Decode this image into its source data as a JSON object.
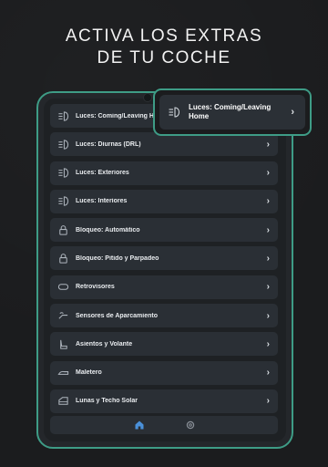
{
  "headline": {
    "line1": "ACTIVA LOS EXTRAS",
    "line2": "DE TU COCHE"
  },
  "colors": {
    "accent": "#3e9c86",
    "background": "#1b1c1e",
    "card": "#2a2f35",
    "home_active": "#4a90d9"
  },
  "menu": {
    "items": [
      {
        "label": "Luces: Coming/Leaving Home",
        "icon": "headlight-icon"
      },
      {
        "label": "Luces: Diurnas (DRL)",
        "icon": "headlight-icon"
      },
      {
        "label": "Luces: Exteriores",
        "icon": "headlight-icon"
      },
      {
        "label": "Luces: Interiores",
        "icon": "headlight-icon"
      },
      {
        "label": "Bloqueo: Automático",
        "icon": "lock-icon"
      },
      {
        "label": "Bloqueo: Pitido y Parpadeo",
        "icon": "lock-icon"
      },
      {
        "label": "Retrovisores",
        "icon": "mirror-icon"
      },
      {
        "label": "Sensores de Aparcamiento",
        "icon": "parking-sensor-icon"
      },
      {
        "label": "Asientos y Volante",
        "icon": "seat-icon"
      },
      {
        "label": "Maletero",
        "icon": "trunk-icon"
      },
      {
        "label": "Lunas y Techo Solar",
        "icon": "window-icon"
      }
    ]
  },
  "popout": {
    "label": "Luces: Coming/Leaving Home",
    "icon": "headlight-icon"
  },
  "bottom_nav": {
    "home_icon": "home-icon",
    "settings_icon": "gear-icon"
  }
}
